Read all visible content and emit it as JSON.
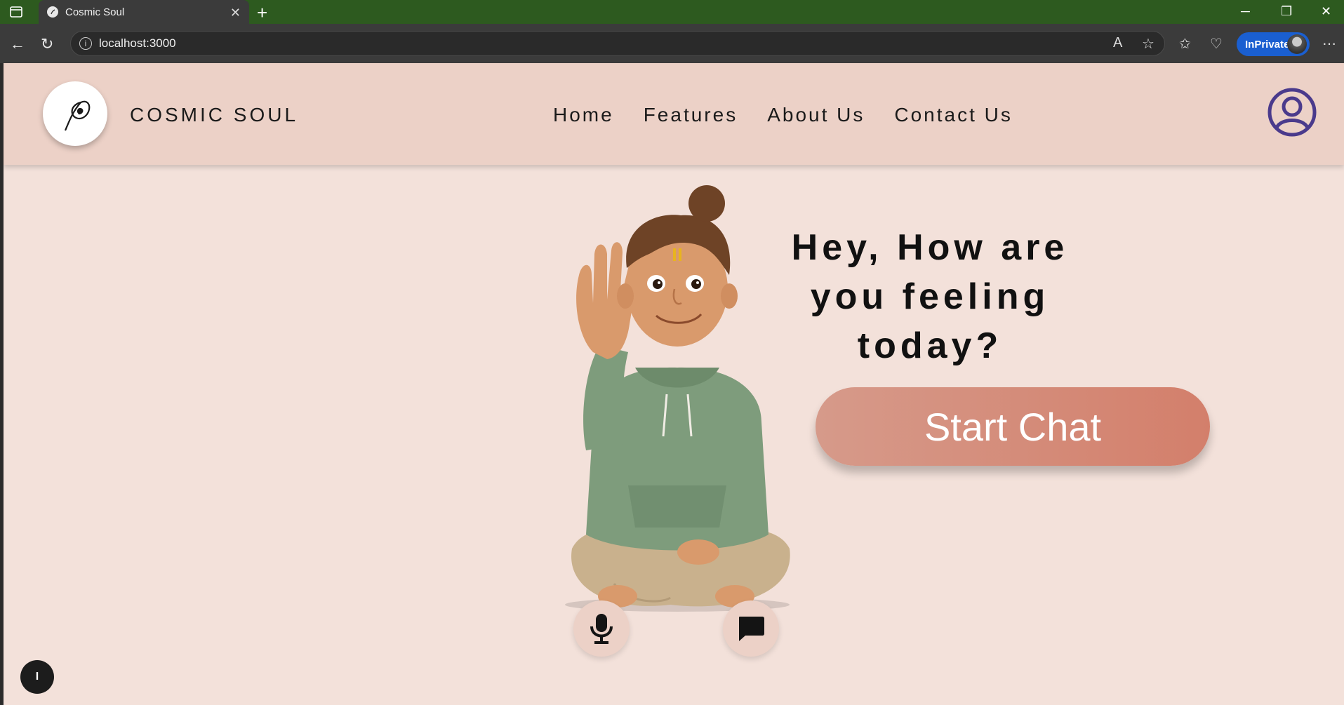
{
  "browser": {
    "tab_title": "Cosmic Soul",
    "url": "localhost:3000",
    "inprivate_label": "InPrivate"
  },
  "header": {
    "brand": "COSMIC SOUL",
    "nav": [
      "Home",
      "Features",
      "About Us",
      "Contact Us"
    ]
  },
  "hero": {
    "greeting": "Hey, How are you feeling today?",
    "start_chat_label": "Start Chat"
  },
  "icons": {
    "logo": "peacock-feather-icon",
    "profile": "user-circle-icon",
    "mic": "microphone-icon",
    "chat": "chat-bubble-icon"
  },
  "floating_badge": "I",
  "colors": {
    "header_bg": "#ecd1c7",
    "page_bg": "#f3e1da",
    "start_chat_gradient": [
      "#d69a8a",
      "#d37f6b"
    ],
    "profile_icon": "#4a3a8c",
    "tabbar": "#2d5a1f"
  }
}
